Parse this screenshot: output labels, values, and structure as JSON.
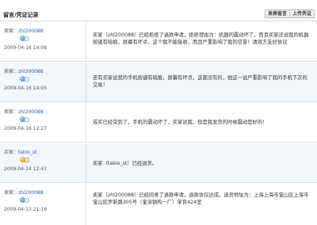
{
  "header": {
    "title": "留言/凭证记录",
    "btn_message": "发表留言",
    "btn_upload": "上传凭证"
  },
  "records": [
    {
      "role": "卖家：",
      "username": "zhl200088",
      "time": "2009-04-16 14:08",
      "content": "买家（zhl200088）已经拒绝了退款申请，拒绝理由为：机器的震动坏了，而且买家还说我的机器按键有暗痕，屏幕有坏点，这个我不能接收，而且严重影响了我的信誉！请双方友好协议"
    },
    {
      "role": "卖家：",
      "username": "zhl200088",
      "time": "2009-04-16 14:05",
      "content": "还有买家说我的手机按键有暗痕，屏幕有坏点，这都没有的，他这一说严重影响了我的手机下次的交易！"
    },
    {
      "role": "卖家：",
      "username": "zhl200088",
      "time": "2009-04-16 12:27",
      "content": "或买已经受到了，手机的震动坏了，买家说我，但是我发货的时候震动是好的！"
    },
    {
      "role": "买家：",
      "username": "takio_st",
      "time": "2009-04-14 12:47",
      "content": "买家（takio_st）已经退货。"
    },
    {
      "role": "卖家：",
      "username": "zhl200088",
      "time": "2009-04-13 21:16",
      "content": "卖家（zhl200088）已经同意了退款申请，退款协议达成。退货地址为：上海上海市宝山区上海市宝山区罗新路305号（宝治钢构一厂）单背424室"
    }
  ]
}
